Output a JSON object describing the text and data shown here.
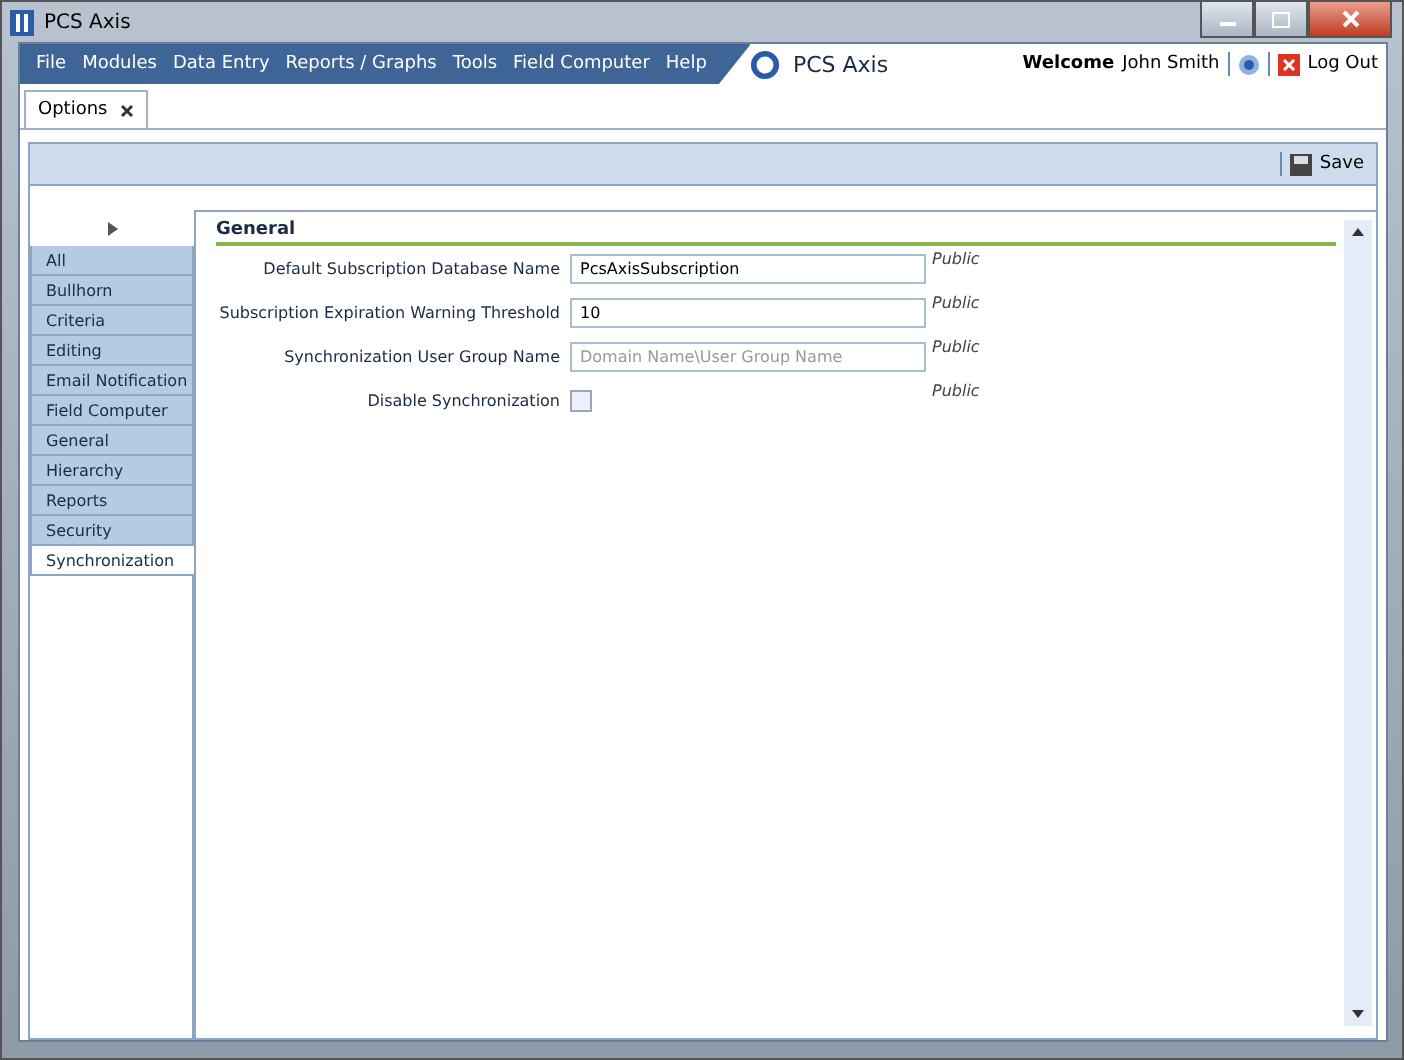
{
  "window": {
    "title": "PCS Axis"
  },
  "menu": [
    "File",
    "Modules",
    "Data Entry",
    "Reports / Graphs",
    "Tools",
    "Field Computer",
    "Help"
  ],
  "brand": "PCS Axis",
  "user": {
    "welcome": "Welcome",
    "name": "John Smith",
    "logout": "Log Out"
  },
  "tabs": [
    {
      "label": "Options",
      "selected": true
    }
  ],
  "toolbar": {
    "save": "Save"
  },
  "sidebar": {
    "items": [
      {
        "label": "All",
        "selected": false
      },
      {
        "label": "Bullhorn",
        "selected": false
      },
      {
        "label": "Criteria",
        "selected": false
      },
      {
        "label": "Editing",
        "selected": false
      },
      {
        "label": "Email Notification",
        "selected": false
      },
      {
        "label": "Field Computer",
        "selected": false
      },
      {
        "label": "General",
        "selected": false
      },
      {
        "label": "Hierarchy",
        "selected": false
      },
      {
        "label": "Reports",
        "selected": false
      },
      {
        "label": "Security",
        "selected": false
      },
      {
        "label": "Synchronization",
        "selected": true
      }
    ]
  },
  "section": {
    "title": "General",
    "fields": [
      {
        "kind": "text",
        "label": "Default Subscription Database Name",
        "value": "PcsAxisSubscription",
        "scope": "Public"
      },
      {
        "kind": "text",
        "label": "Subscription Expiration Warning Threshold",
        "value": "10",
        "scope": "Public"
      },
      {
        "kind": "text",
        "label": "Synchronization User Group Name",
        "placeholder": "Domain Name\\User Group Name",
        "scope": "Public"
      },
      {
        "kind": "checkbox",
        "label": "Disable Synchronization",
        "checked": false,
        "scope": "Public"
      }
    ]
  }
}
